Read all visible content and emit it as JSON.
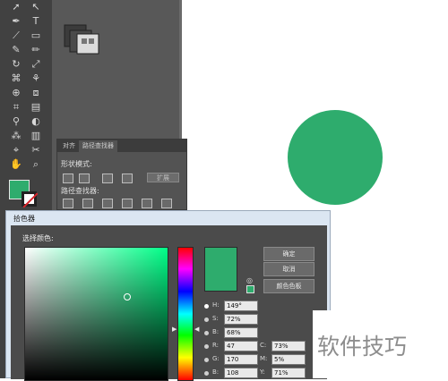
{
  "toolbar": {
    "tool_icons": [
      "selection-icon",
      "direct-selection-icon",
      "pen-icon",
      "type-icon",
      "line-icon",
      "rectangle-icon",
      "paintbrush-icon",
      "pencil-icon",
      "rotate-icon",
      "scale-icon",
      "width-icon",
      "warp-icon",
      "shape-builder-icon",
      "perspective-icon",
      "mesh-icon",
      "gradient-icon",
      "eyedropper-icon",
      "blend-icon",
      "symbol-sprayer-icon",
      "column-graph-icon",
      "artboard-icon",
      "slice-icon",
      "hand-icon",
      "zoom-icon"
    ],
    "fill_color": "#2eac6d",
    "stroke": "none"
  },
  "pathfinder_panel": {
    "tabs": [
      "对齐",
      "路径查找器"
    ],
    "shape_modes_label": "形状模式:",
    "expand_button": "扩展",
    "pathfinder_label": "路径查找器:"
  },
  "canvas": {
    "circle_color": "#2eac6d"
  },
  "picker": {
    "title": "拾色器",
    "select_label": "选择颜色:",
    "buttons": {
      "ok": "确定",
      "cancel": "取消",
      "swatches": "颜色色板"
    },
    "fields": {
      "H": {
        "label": "H:",
        "value": "149°"
      },
      "S": {
        "label": "S:",
        "value": "72%"
      },
      "B": {
        "label": "B:",
        "value": "68%"
      },
      "R": {
        "label": "R:",
        "value": "47"
      },
      "G": {
        "label": "G:",
        "value": "170"
      },
      "Bl": {
        "label": "B:",
        "value": "108"
      },
      "C": {
        "label": "C:",
        "value": "73%"
      },
      "M": {
        "label": "M:",
        "value": "5%"
      },
      "Y": {
        "label": "Y:",
        "value": "71%"
      }
    },
    "current_color": "#2eac6d"
  },
  "watermark": "软件技巧"
}
